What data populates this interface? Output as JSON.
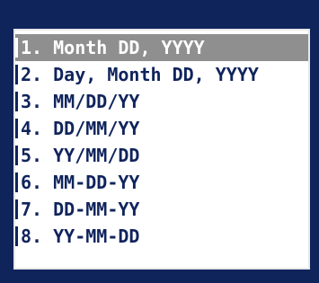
{
  "format_menu": {
    "selected_index": 0,
    "items": [
      {
        "label": "1. Month DD, YYYY"
      },
      {
        "label": "2. Day, Month DD, YYYY"
      },
      {
        "label": "3. MM/DD/YY"
      },
      {
        "label": "4. DD/MM/YY"
      },
      {
        "label": "5. YY/MM/DD"
      },
      {
        "label": "6. MM-DD-YY"
      },
      {
        "label": "7. DD-MM-YY"
      },
      {
        "label": "8. YY-MM-DD"
      }
    ]
  },
  "colors": {
    "frame": "#10245c",
    "text": "#10245c",
    "list_background": "#ffffff",
    "selection_background": "#8f8f8f",
    "selection_text": "#ffffff"
  }
}
